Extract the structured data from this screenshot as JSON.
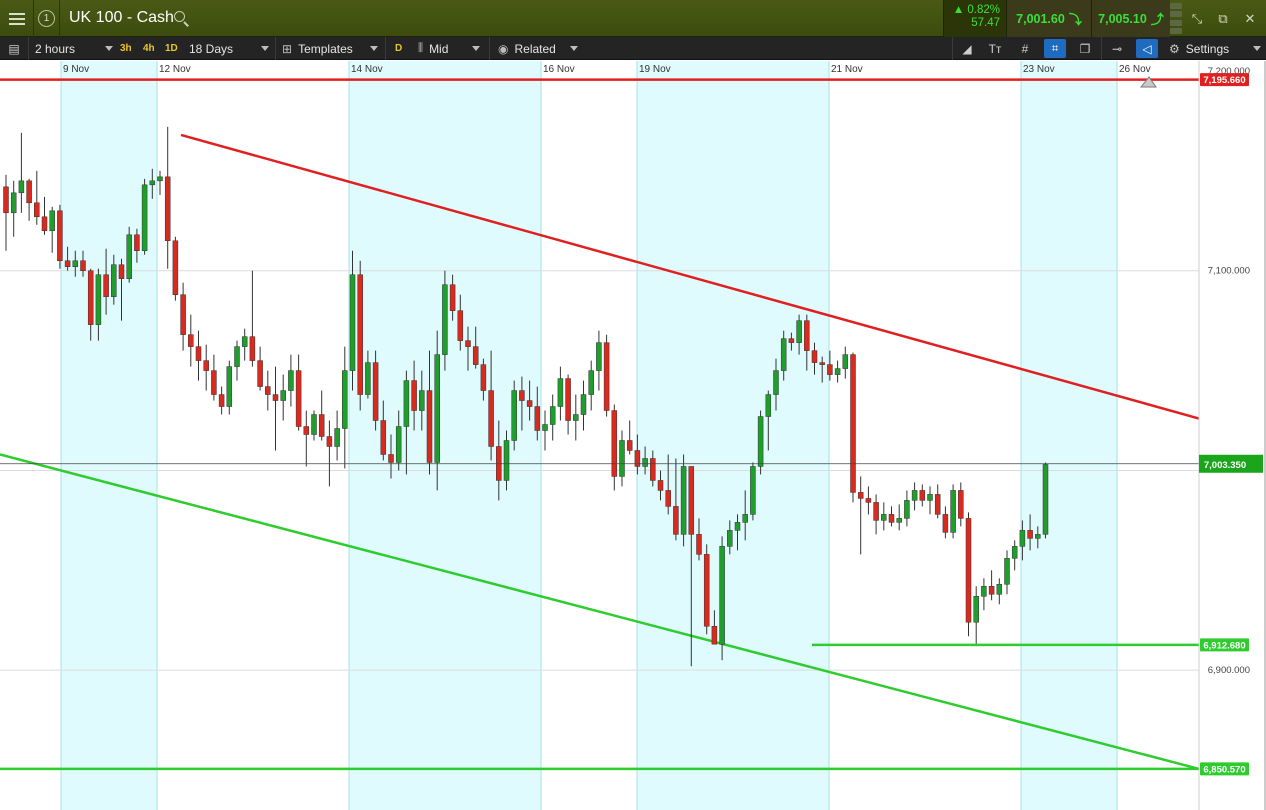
{
  "header": {
    "info_label": "1",
    "market_title": "UK 100 - Cash",
    "change_percent": "▲ 0.82%",
    "change_points": "57.47",
    "sell_price": "7,001.60",
    "buy_price": "7,005.10"
  },
  "toolbar": {
    "interval": "2 hours",
    "quick_intervals": [
      "3h",
      "4h",
      "1D"
    ],
    "period": "18 Days",
    "templates_label": "Templates",
    "candle_type_chip": "D",
    "price_type": "Mid",
    "related_label": "Related",
    "settings_label": "Settings"
  },
  "colors": {
    "bull": "#1f9d2d",
    "bear": "#d82a1e",
    "resistance_line": "#e02020",
    "support_line": "#2ecc2e",
    "band": "#e0fbfd",
    "grid": "#a8e2e6",
    "current_price_tag": "#1aa51a"
  },
  "chart_data": {
    "type": "candlestick",
    "date_labels": [
      "9 Nov",
      "12 Nov",
      "14 Nov",
      "16 Nov",
      "19 Nov",
      "21 Nov",
      "23 Nov",
      "26 Nov"
    ],
    "y_axis_ticks": [
      "7,200.000",
      "7,100.000",
      "6,900.000"
    ],
    "ylim": [
      6830,
      7205
    ],
    "candles": [
      [
        7142,
        7148,
        7110,
        7129
      ],
      [
        7129,
        7145,
        7117,
        7139
      ],
      [
        7139,
        7169,
        7129,
        7145
      ],
      [
        7145,
        7146,
        7125,
        7134
      ],
      [
        7134,
        7150,
        7123,
        7127
      ],
      [
        7127,
        7137,
        7118,
        7120
      ],
      [
        7120,
        7132,
        7109,
        7130
      ],
      [
        7130,
        7133,
        7101,
        7105
      ],
      [
        7105,
        7112,
        7100,
        7102
      ],
      [
        7102,
        7110,
        7097,
        7105
      ],
      [
        7105,
        7110,
        7097,
        7100
      ],
      [
        7100,
        7101,
        7065,
        7073
      ],
      [
        7073,
        7101,
        7065,
        7098
      ],
      [
        7098,
        7111,
        7078,
        7087
      ],
      [
        7087,
        7108,
        7083,
        7103
      ],
      [
        7103,
        7106,
        7075,
        7096
      ],
      [
        7096,
        7122,
        7094,
        7118
      ],
      [
        7118,
        7121,
        7104,
        7110
      ],
      [
        7110,
        7146,
        7108,
        7143
      ],
      [
        7143,
        7151,
        7136,
        7145
      ],
      [
        7145,
        7150,
        7138,
        7147
      ],
      [
        7147,
        7172,
        7101,
        7115
      ],
      [
        7115,
        7117,
        7085,
        7088
      ],
      [
        7088,
        7094,
        7060,
        7068
      ],
      [
        7068,
        7078,
        7052,
        7062
      ],
      [
        7062,
        7070,
        7045,
        7055
      ],
      [
        7055,
        7063,
        7040,
        7050
      ],
      [
        7050,
        7058,
        7035,
        7038
      ],
      [
        7038,
        7042,
        7028,
        7032
      ],
      [
        7032,
        7055,
        7028,
        7052
      ],
      [
        7052,
        7065,
        7045,
        7062
      ],
      [
        7062,
        7071,
        7055,
        7067
      ],
      [
        7067,
        7100,
        7052,
        7055
      ],
      [
        7055,
        7062,
        7040,
        7042
      ],
      [
        7042,
        7050,
        7030,
        7038
      ],
      [
        7038,
        7052,
        7010,
        7035
      ],
      [
        7035,
        7048,
        7025,
        7040
      ],
      [
        7040,
        7058,
        7032,
        7050
      ],
      [
        7050,
        7058,
        7020,
        7022
      ],
      [
        7022,
        7030,
        7002,
        7018
      ],
      [
        7018,
        7030,
        7015,
        7028
      ],
      [
        7028,
        7040,
        7015,
        7017
      ],
      [
        7017,
        7025,
        6992,
        7012
      ],
      [
        7012,
        7030,
        7005,
        7021
      ],
      [
        7021,
        7062,
        7001,
        7050
      ],
      [
        7050,
        7110,
        7040,
        7098
      ],
      [
        7098,
        7105,
        7030,
        7038
      ],
      [
        7038,
        7060,
        7036,
        7054
      ],
      [
        7054,
        7060,
        7020,
        7025
      ],
      [
        7025,
        7035,
        7005,
        7008
      ],
      [
        7008,
        7018,
        6996,
        7004
      ],
      [
        7004,
        7030,
        7000,
        7022
      ],
      [
        7022,
        7050,
        6998,
        7045
      ],
      [
        7045,
        7055,
        7020,
        7030
      ],
      [
        7030,
        7050,
        7020,
        7040
      ],
      [
        7040,
        7060,
        6998,
        7004
      ],
      [
        7004,
        7070,
        6990,
        7058
      ],
      [
        7058,
        7100,
        7050,
        7093
      ],
      [
        7093,
        7098,
        7075,
        7080
      ],
      [
        7080,
        7088,
        7060,
        7065
      ],
      [
        7065,
        7072,
        7050,
        7062
      ],
      [
        7062,
        7072,
        7051,
        7053
      ],
      [
        7053,
        7056,
        7035,
        7040
      ],
      [
        7040,
        7060,
        7005,
        7012
      ],
      [
        7012,
        7025,
        6985,
        6995
      ],
      [
        6995,
        7020,
        6990,
        7015
      ],
      [
        7015,
        7045,
        7010,
        7040
      ],
      [
        7040,
        7047,
        7020,
        7035
      ],
      [
        7035,
        7045,
        7025,
        7032
      ],
      [
        7032,
        7042,
        7015,
        7020
      ],
      [
        7020,
        7030,
        7010,
        7023
      ],
      [
        7023,
        7038,
        7015,
        7032
      ],
      [
        7032,
        7052,
        7025,
        7046
      ],
      [
        7046,
        7048,
        7018,
        7025
      ],
      [
        7025,
        7038,
        7015,
        7028
      ],
      [
        7028,
        7045,
        7020,
        7038
      ],
      [
        7038,
        7055,
        7030,
        7050
      ],
      [
        7050,
        7070,
        7040,
        7064
      ],
      [
        7064,
        7068,
        7027,
        7030
      ],
      [
        7030,
        7033,
        6990,
        6997
      ],
      [
        6997,
        7020,
        6992,
        7015
      ],
      [
        7015,
        7025,
        7008,
        7010
      ],
      [
        7010,
        7018,
        6998,
        7002
      ],
      [
        7002,
        7012,
        6998,
        7006
      ],
      [
        7006,
        7010,
        6992,
        6995
      ],
      [
        6995,
        7000,
        6985,
        6990
      ],
      [
        6990,
        7008,
        6978,
        6982
      ],
      [
        6982,
        7006,
        6965,
        6968
      ],
      [
        6968,
        7008,
        6962,
        7002
      ],
      [
        7002,
        7002,
        6902,
        6968
      ],
      [
        6968,
        6976,
        6955,
        6958
      ],
      [
        6958,
        6963,
        6918,
        6922
      ],
      [
        6922,
        6930,
        6913,
        6913
      ],
      [
        6913,
        6967,
        6905,
        6962
      ],
      [
        6962,
        6975,
        6958,
        6970
      ],
      [
        6970,
        6978,
        6960,
        6974
      ],
      [
        6974,
        6990,
        6965,
        6978
      ],
      [
        6978,
        7004,
        6975,
        7002
      ],
      [
        7002,
        7030,
        6998,
        7027
      ],
      [
        7027,
        7040,
        7010,
        7038
      ],
      [
        7038,
        7056,
        7030,
        7050
      ],
      [
        7050,
        7070,
        7045,
        7066
      ],
      [
        7066,
        7069,
        7060,
        7064
      ],
      [
        7064,
        7078,
        7058,
        7075
      ],
      [
        7075,
        7078,
        7050,
        7060
      ],
      [
        7060,
        7064,
        7048,
        7054
      ],
      [
        7054,
        7057,
        7044,
        7053
      ],
      [
        7053,
        7060,
        7045,
        7048
      ],
      [
        7048,
        7055,
        7044,
        7051
      ],
      [
        7051,
        7062,
        7046,
        7058
      ],
      [
        7058,
        7059,
        6984,
        6989
      ],
      [
        6989,
        6997,
        6958,
        6986
      ],
      [
        6986,
        6992,
        6978,
        6984
      ],
      [
        6984,
        6988,
        6968,
        6975
      ],
      [
        6975,
        6984,
        6970,
        6978
      ],
      [
        6978,
        6982,
        6972,
        6974
      ],
      [
        6974,
        6983,
        6970,
        6976
      ],
      [
        6976,
        6990,
        6972,
        6985
      ],
      [
        6985,
        6994,
        6980,
        6990
      ],
      [
        6990,
        6993,
        6982,
        6985
      ],
      [
        6985,
        6992,
        6978,
        6988
      ],
      [
        6988,
        6993,
        6976,
        6978
      ],
      [
        6978,
        6982,
        6966,
        6969
      ],
      [
        6969,
        6993,
        6966,
        6990
      ],
      [
        6990,
        6994,
        6972,
        6976
      ],
      [
        6976,
        6979,
        6917,
        6924
      ],
      [
        6924,
        6942,
        6912,
        6937
      ],
      [
        6937,
        6946,
        6930,
        6942
      ],
      [
        6942,
        6950,
        6935,
        6938
      ],
      [
        6938,
        6946,
        6933,
        6943
      ],
      [
        6943,
        6960,
        6938,
        6956
      ],
      [
        6956,
        6965,
        6950,
        6962
      ],
      [
        6962,
        6975,
        6955,
        6970
      ],
      [
        6970,
        6978,
        6960,
        6966
      ],
      [
        6966,
        6972,
        6961,
        6968
      ],
      [
        6968,
        7004,
        6966,
        7003
      ]
    ],
    "resistance_line": {
      "label": "7,195.660",
      "value": 7195.66
    },
    "support_line_1": {
      "label": "6,912.680",
      "value": 6912.68
    },
    "support_line_2": {
      "label": "6,850.570",
      "value": 6850.57
    },
    "current_price": {
      "label": "7,003.350",
      "value": 7003.35
    },
    "downtrend_upper_value_start": 7168,
    "downtrend_upper_value_end": 7026,
    "downtrend_lower_value_start": 7008,
    "downtrend_lower_value_end": 6850.57
  }
}
